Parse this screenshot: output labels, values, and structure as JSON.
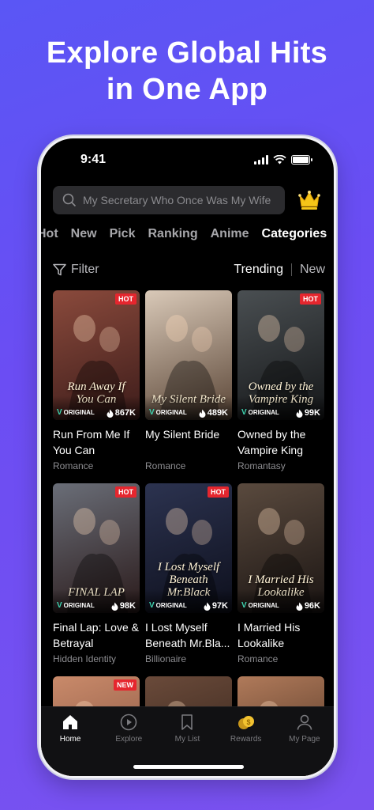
{
  "promo": {
    "line1": "Explore Global Hits",
    "line2": "in One App"
  },
  "status_bar": {
    "time": "9:41"
  },
  "search": {
    "placeholder": "My Secretary Who Once Was My Wife"
  },
  "tabs": [
    {
      "label": "Hot"
    },
    {
      "label": "New"
    },
    {
      "label": "Pick"
    },
    {
      "label": "Ranking"
    },
    {
      "label": "Anime"
    },
    {
      "label": "Categories",
      "active": true
    }
  ],
  "filter": {
    "label": "Filter"
  },
  "sort": {
    "trending": "Trending",
    "new": "New",
    "selected": "Trending"
  },
  "cards": [
    {
      "cover_title": "Run Away If You Can",
      "badge": "HOT",
      "original": "ORIGINAL",
      "views": "867K",
      "name": "Run From Me If You Can",
      "genre": "Romance",
      "colors": [
        "#8a4a3c",
        "#3d1c1a"
      ]
    },
    {
      "cover_title": "My Silent Bride",
      "badge": "",
      "original": "ORIGINAL",
      "views": "489K",
      "name": "My Silent Bride",
      "genre": "Romance",
      "colors": [
        "#d9c9b8",
        "#5a4536"
      ]
    },
    {
      "cover_title": "Owned by the Vampire King",
      "badge": "HOT",
      "original": "ORIGINAL",
      "views": "99K",
      "name": "Owned by the Vampire King",
      "genre": "Romantasy",
      "colors": [
        "#4a4f52",
        "#141618"
      ]
    },
    {
      "cover_title": "FINAL LAP",
      "badge": "HOT",
      "original": "ORIGINAL",
      "views": "98K",
      "name": "Final Lap: Love & Betrayal",
      "genre": "Hidden Identity",
      "colors": [
        "#6a6e78",
        "#2a1a1a"
      ]
    },
    {
      "cover_title": "I Lost Myself Beneath Mr.Black",
      "badge": "HOT",
      "original": "ORIGINAL",
      "views": "97K",
      "name": "I Lost Myself Beneath Mr.Bla...",
      "genre": "Billionaire",
      "colors": [
        "#2c3350",
        "#0d0f1c"
      ]
    },
    {
      "cover_title": "I Married His Lookalike",
      "badge": "",
      "original": "ORIGINAL",
      "views": "96K",
      "name": "I Married His Lookalike",
      "genre": "Romance",
      "colors": [
        "#5a4a3e",
        "#1a1412"
      ]
    },
    {
      "cover_title": "",
      "badge": "NEW",
      "original": "",
      "views": "",
      "name": "",
      "genre": "",
      "colors": [
        "#c98a6a",
        "#7a4a3a"
      ]
    },
    {
      "cover_title": "",
      "badge": "",
      "original": "",
      "views": "",
      "name": "",
      "genre": "",
      "colors": [
        "#6a4a3a",
        "#2a1c14"
      ]
    },
    {
      "cover_title": "",
      "badge": "",
      "original": "",
      "views": "",
      "name": "",
      "genre": "",
      "colors": [
        "#b07a5a",
        "#3a2418"
      ]
    }
  ],
  "nav": [
    {
      "label": "Home",
      "icon": "home-icon",
      "active": true
    },
    {
      "label": "Explore",
      "icon": "play-circle-icon"
    },
    {
      "label": "My List",
      "icon": "bookmark-icon"
    },
    {
      "label": "Rewards",
      "icon": "coins-icon"
    },
    {
      "label": "My Page",
      "icon": "user-icon"
    }
  ],
  "colors": {
    "background": "#6450f4",
    "active_tab": "#ffffff",
    "badge": "#e5262e",
    "original_mark": "#3fd4b0"
  }
}
